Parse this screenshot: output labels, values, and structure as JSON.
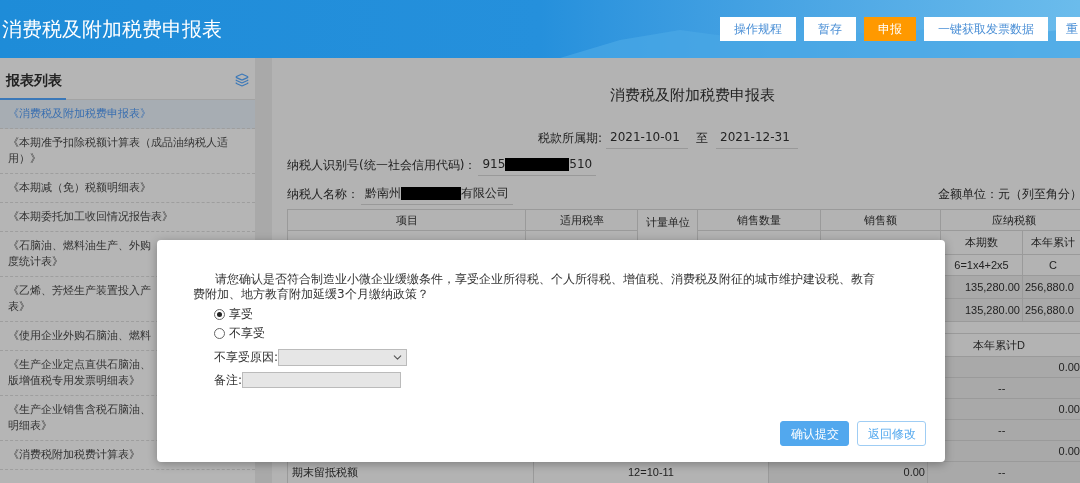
{
  "header": {
    "title": "消费税及附加税费申报表",
    "buttons": [
      {
        "label": "操作规程",
        "kind": "default"
      },
      {
        "label": "暂存",
        "kind": "default"
      },
      {
        "label": "申报",
        "kind": "primary"
      },
      {
        "label": "一键获取发票数据",
        "kind": "default"
      },
      {
        "label": "重",
        "kind": "default"
      }
    ]
  },
  "sidebar": {
    "title": "报表列表",
    "items": [
      {
        "lines": [
          "《消费税及附加税费申报表》"
        ],
        "selected": true
      },
      {
        "lines": [
          "《本期准予扣除税额计算表（成品油纳税人适",
          "用）》"
        ],
        "selected": false
      },
      {
        "lines": [
          "《本期减（免）税额明细表》"
        ],
        "selected": false
      },
      {
        "lines": [
          "《本期委托加工收回情况报告表》"
        ],
        "selected": false
      },
      {
        "lines": [
          "《石脑油、燃料油生产、外购",
          "度统计表》"
        ],
        "selected": false
      },
      {
        "lines": [
          "《乙烯、芳烃生产装置投入产",
          "表》"
        ],
        "selected": false
      },
      {
        "lines": [
          "《使用企业外购石脑油、燃料"
        ],
        "selected": false
      },
      {
        "lines": [
          "《生产企业定点直供石脑油、",
          "版增值税专用发票明细表》"
        ],
        "selected": false
      },
      {
        "lines": [
          "《生产企业销售含税石脑油、",
          "明细表》"
        ],
        "selected": false
      },
      {
        "lines": [
          "《消费税附加税费计算表》"
        ],
        "selected": false
      }
    ]
  },
  "form": {
    "title": "消费税及附加税费申报表",
    "period_label": "税款所属期:",
    "period_start": "2021-10-01",
    "period_sep": "至",
    "period_end": "2021-12-31",
    "taxpayer_id_label": "纳税人识别号(统一社会信用代码)：",
    "taxpayer_id_start": "915",
    "taxpayer_id_end": "510",
    "taxpayer_name_label": "纳税人名称：",
    "taxpayer_name_start": "黔南州",
    "taxpayer_name_end": "有限公司",
    "unit_note": "金额单位：元（列至角分）"
  },
  "table": {
    "headers": [
      "项目",
      "适用税率",
      "计量单位",
      "销售数量",
      "销售额",
      "应纳税额"
    ],
    "sub_headers": [
      "本期数",
      "本年累计"
    ],
    "rows": [
      [
        "6=1x4+2x5",
        "C"
      ],
      [
        "135,280.00",
        "256,880.0"
      ],
      [
        "135,280.00",
        "256,880.0"
      ]
    ],
    "section_header": "本年累计D",
    "section_values": [
      {
        "value": "0.00",
        "kind": "number"
      },
      {
        "value": "--",
        "kind": "dash"
      },
      {
        "value": "0.00",
        "kind": "number"
      },
      {
        "value": "--",
        "kind": "dash"
      },
      {
        "value": "0.00",
        "kind": "number"
      }
    ],
    "last_row": [
      "期末留抵税额",
      "12=10-11",
      "0.00",
      "--"
    ]
  },
  "dialog": {
    "message": "请您确认是否符合制造业小微企业缓缴条件，享受企业所得税、个人所得税、增值税、消费税及附征的城市维护建设税、教育费附加、地方教育附加延缓3个月缴纳政策？",
    "options": [
      {
        "label": "享受",
        "selected": true
      },
      {
        "label": "不享受",
        "selected": false
      }
    ],
    "reason_label": "不享受原因:",
    "remark_label": "备注:",
    "buttons": [
      {
        "label": "确认提交",
        "kind": "primary"
      },
      {
        "label": "返回修改",
        "kind": "default"
      }
    ]
  }
}
